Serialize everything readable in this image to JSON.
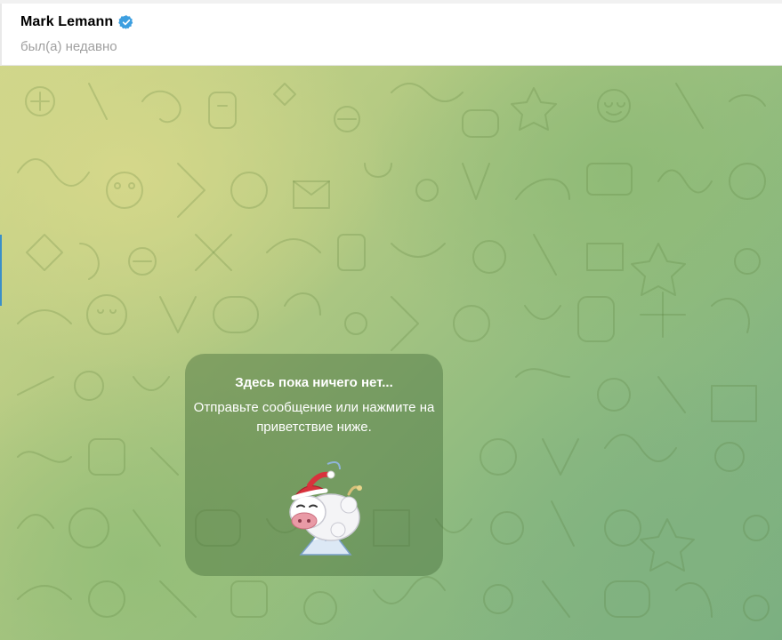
{
  "header": {
    "contact_name": "Mark Lemann",
    "status": "был(а) недавно",
    "verified_icon": "verified-badge-icon",
    "verified_color": "#3d9fe0"
  },
  "chat": {
    "empty_state": {
      "title": "Здесь пока ничего нет...",
      "description": "Отправьте сообщение или нажмите на приветствие ниже.",
      "greeting_sticker": "cow-santa-hat-sticker"
    },
    "background_colors": [
      "#cfd68a",
      "#b2c982",
      "#8fbb80",
      "#78ad82"
    ]
  }
}
